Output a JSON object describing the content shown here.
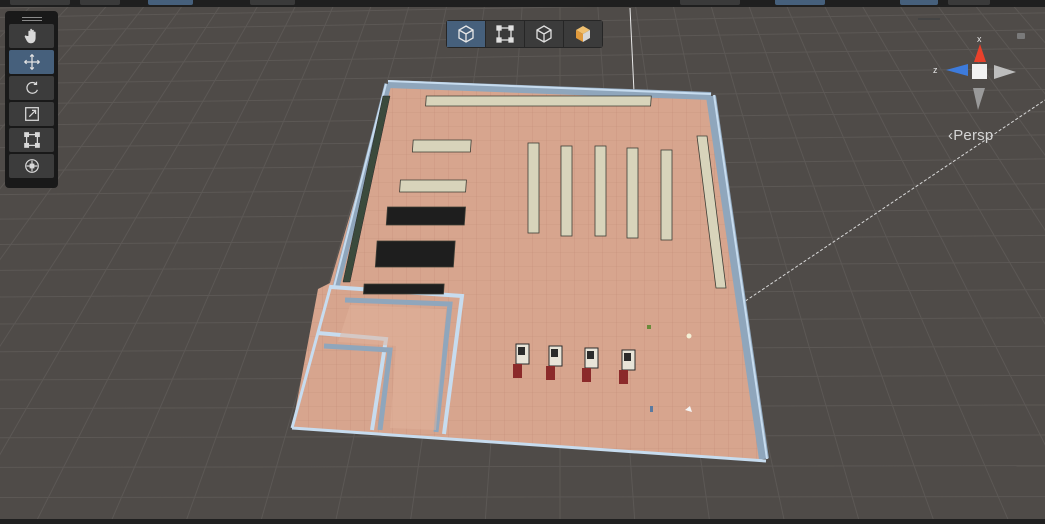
{
  "toolbar": {
    "tools": [
      {
        "id": "hand",
        "icon": "hand-icon",
        "active": false
      },
      {
        "id": "move",
        "icon": "move-icon",
        "active": true
      },
      {
        "id": "rotate",
        "icon": "rotate-icon",
        "active": false
      },
      {
        "id": "scale",
        "icon": "scale-icon",
        "active": false
      },
      {
        "id": "rect",
        "icon": "rect-transform-icon",
        "active": false
      },
      {
        "id": "transform",
        "icon": "transform-icon",
        "active": false
      }
    ]
  },
  "view_modes": [
    {
      "icon": "cube-wire-icon",
      "active": true
    },
    {
      "icon": "rect-icon",
      "active": false
    },
    {
      "icon": "cube-outline-icon",
      "active": false
    },
    {
      "icon": "cube-shaded-icon",
      "active": false
    }
  ],
  "gizmo": {
    "projection_label": "Persp",
    "axis_x": "x",
    "axis_z": "z",
    "colors": {
      "x": "#e8412b",
      "y": "#9ad04a",
      "z": "#3d7bdc",
      "neutral": "#bdbdbd"
    }
  },
  "colors": {
    "background": "#4f4b48",
    "floor": "#d7a58e",
    "wall_top": "#c7dcef",
    "wall_side": "#8fa6bc",
    "shelf": "#d8d4bb",
    "black_shelf": "#1e1e1e",
    "accent_selected": "#46607c"
  }
}
